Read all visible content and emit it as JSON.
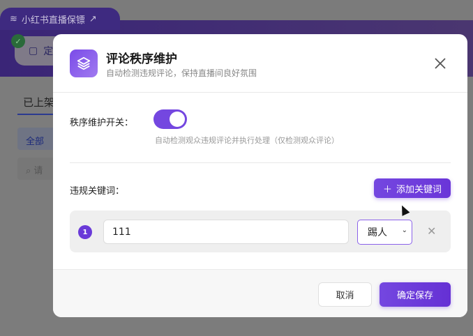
{
  "background": {
    "app_tab": "小红书直播保镖",
    "pill_text": "定",
    "listed_tab": "已上架",
    "filter_all": "全部",
    "search_placeholder": "请"
  },
  "modal": {
    "title": "评论秩序维护",
    "subtitle": "自动检测违规评论，保持直播间良好氛围",
    "toggle_label": "秩序维护开关：",
    "toggle_on": true,
    "toggle_hint": "自动检测观众违规评论并执行处理（仅检测观众评论）",
    "keywords_label": "违规关键词：",
    "add_button": "添加关键词",
    "keywords": [
      {
        "index": "1",
        "value": "111",
        "action": "踢人"
      }
    ],
    "cancel": "取消",
    "save": "确定保存"
  },
  "colors": {
    "accent": "#7447e0"
  }
}
